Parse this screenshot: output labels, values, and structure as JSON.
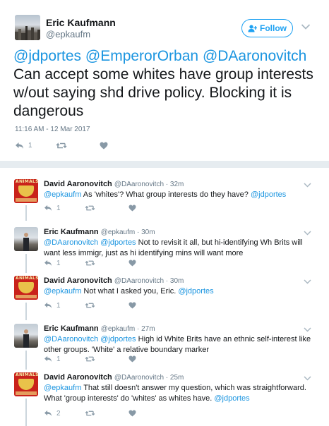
{
  "main_tweet": {
    "author_name": "Eric Kaufmann",
    "author_handle": "@epkaufm",
    "follow_label": "Follow",
    "mentions": [
      "@jdportes",
      "@EmperorOrban",
      "@DAaronovitch"
    ],
    "text": "Can accept some whites have group interests w/out saying shd drive policy. Blocking it is dangerous",
    "timestamp": "11:16 AM - 12 Mar 2017",
    "reply_count": "1"
  },
  "replies": [
    {
      "name": "David Aaronovitch",
      "handle": "@DAaronovitch",
      "time": "32m",
      "lead_mention": "@epkaufm",
      "text": " As 'whites'? What group interests do they have? ",
      "trail_mention": "@jdportes",
      "reply_count": "1"
    },
    {
      "name": "Eric Kaufmann",
      "handle": "@epkaufm",
      "time": "30m",
      "lead_mention": "@DAaronovitch @jdportes",
      "text": " Not to revisit it all, but hi-identifying Wh Brits will want less immigr, just as hi identifying mins will want more",
      "trail_mention": "",
      "reply_count": "1"
    },
    {
      "name": "David Aaronovitch",
      "handle": "@DAaronovitch",
      "time": "30m",
      "lead_mention": "@epkaufm",
      "text": " Not what I asked you, Eric. ",
      "trail_mention": "@jdportes",
      "reply_count": "1"
    },
    {
      "name": "Eric Kaufmann",
      "handle": "@epkaufm",
      "time": "27m",
      "lead_mention": "@DAaronovitch @jdportes",
      "text": " High id White Brits have an ethnic self-interest like other groups. 'White' a relative boundary marker",
      "trail_mention": "",
      "reply_count": "1"
    },
    {
      "name": "David Aaronovitch",
      "handle": "@DAaronovitch",
      "time": "25m",
      "lead_mention": "@epkaufm",
      "text": " That still doesn't answer my question, which was straightforward. What 'group interests' do 'whites' as whites have. ",
      "trail_mention": "@jdportes",
      "reply_count": "2"
    }
  ],
  "da_avatar_text": "ANIMALS",
  "separator": " · ",
  "colors": {
    "link": "#1b95e0",
    "follow": "#1da1f2",
    "muted": "#657786",
    "icon": "#8899a6",
    "thread": "#ccd6dd"
  },
  "icons": {
    "reply": "reply-icon",
    "retweet": "retweet-icon",
    "like": "heart-icon",
    "more": "chevron-down-icon",
    "follow": "add-user-icon"
  }
}
